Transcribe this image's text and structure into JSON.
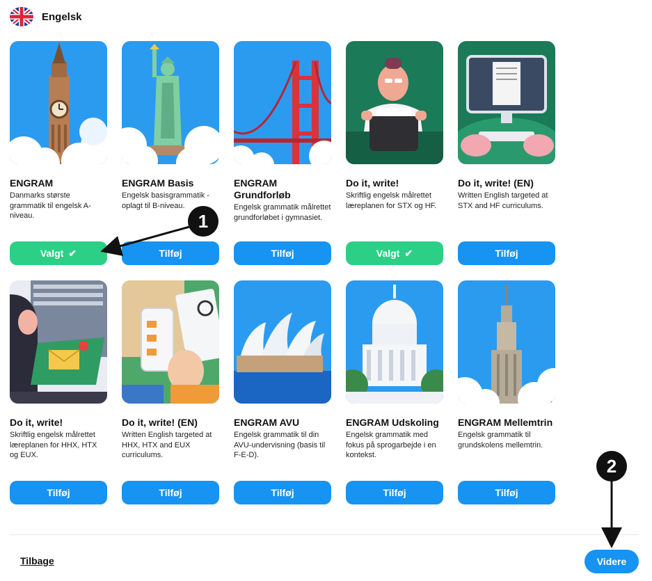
{
  "header": {
    "title": "Engelsk",
    "flag_icon": "uk-flag-icon"
  },
  "selected_label": "Valgt",
  "add_label": "Tilføj",
  "colors": {
    "primary": "#1793f2",
    "selected": "#2bd086"
  },
  "products": [
    {
      "title": "ENGRAM",
      "desc": "Danmarks største grammatik til engelsk A-niveau.",
      "selected": true,
      "illustration": "big-ben"
    },
    {
      "title": "ENGRAM Basis",
      "desc": "Engelsk basisgrammatik - oplagt til B-niveau.",
      "selected": false,
      "illustration": "statue-of-liberty"
    },
    {
      "title": "ENGRAM Grundforløb",
      "desc": "Engelsk grammatik målrettet grundforløbet i gymnasiet.",
      "selected": false,
      "illustration": "golden-gate-bridge"
    },
    {
      "title": "Do it, write!",
      "desc": "Skriftlig engelsk målrettet læreplanen for STX og HF.",
      "selected": true,
      "illustration": "typewriter-man"
    },
    {
      "title": "Do it, write! (EN)",
      "desc": "Written English targeted at STX and HF curriculums.",
      "selected": false,
      "illustration": "computer-hands"
    },
    {
      "title": "Do it, write!",
      "desc": "Skriftlig engelsk målrettet læreplanen for HHX, HTX og EUX.",
      "selected": false,
      "illustration": "woman-laptop"
    },
    {
      "title": "Do it, write! (EN)",
      "desc": "Written English targeted at HHX, HTX and EUX curriculums.",
      "selected": false,
      "illustration": "phone-hand"
    },
    {
      "title": "ENGRAM AVU",
      "desc": "Engelsk grammatik til din AVU-undervisning (basis til F-E-D).",
      "selected": false,
      "illustration": "sydney-opera-house"
    },
    {
      "title": "ENGRAM Udskoling",
      "desc": "Engelsk grammatik med fokus på sprogarbejde i en kontekst.",
      "selected": false,
      "illustration": "us-capitol"
    },
    {
      "title": "ENGRAM Mellemtrin",
      "desc": "Engelsk grammatik til grundskolens mellemtrin.",
      "selected": false,
      "illustration": "empire-state-building"
    }
  ],
  "footer": {
    "back_label": "Tilbage",
    "next_label": "Videre"
  },
  "annotations": [
    {
      "label": "1"
    },
    {
      "label": "2"
    }
  ]
}
